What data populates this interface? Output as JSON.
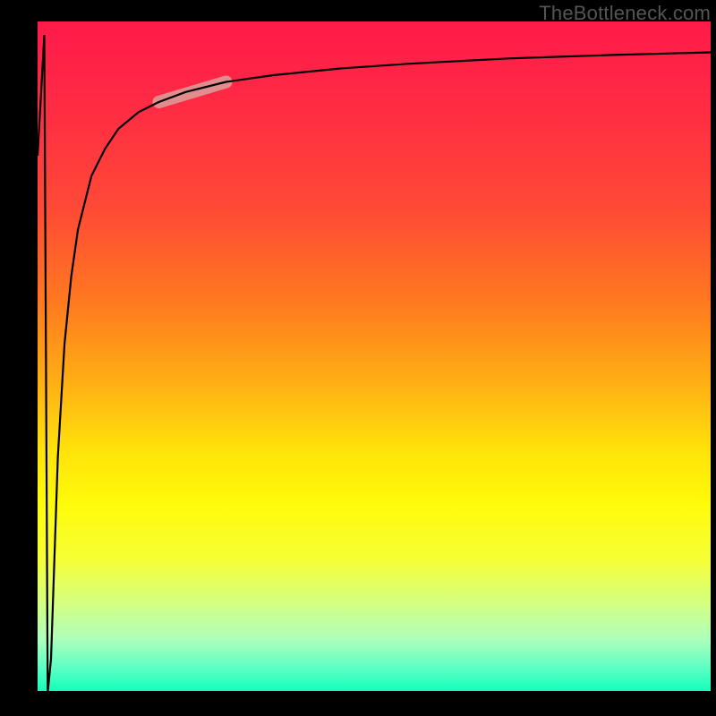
{
  "watermark": "TheBottleneck.com",
  "colors": {
    "gradient_top": "#ff1a4a",
    "gradient_bottom": "#0effb9",
    "highlight": "#d9a09a",
    "curve": "#000000"
  },
  "chart_data": {
    "type": "line",
    "title": "",
    "xlabel": "",
    "ylabel": "",
    "xlim": [
      0,
      100
    ],
    "ylim": [
      0,
      100
    ],
    "grid": false,
    "series": [
      {
        "name": "curve",
        "x": [
          0,
          1,
          1.5,
          2,
          3,
          4,
          5,
          6,
          8,
          10,
          12,
          15,
          18,
          22,
          28,
          35,
          45,
          55,
          70,
          85,
          100
        ],
        "y": [
          80,
          98,
          0,
          5,
          35,
          52,
          62,
          69,
          77,
          81,
          84,
          86.5,
          88,
          89.5,
          91,
          92,
          93,
          93.7,
          94.5,
          95,
          95.4
        ]
      }
    ],
    "highlight_segment": {
      "x": [
        18,
        28
      ],
      "y": [
        88,
        91
      ]
    },
    "annotations": []
  }
}
